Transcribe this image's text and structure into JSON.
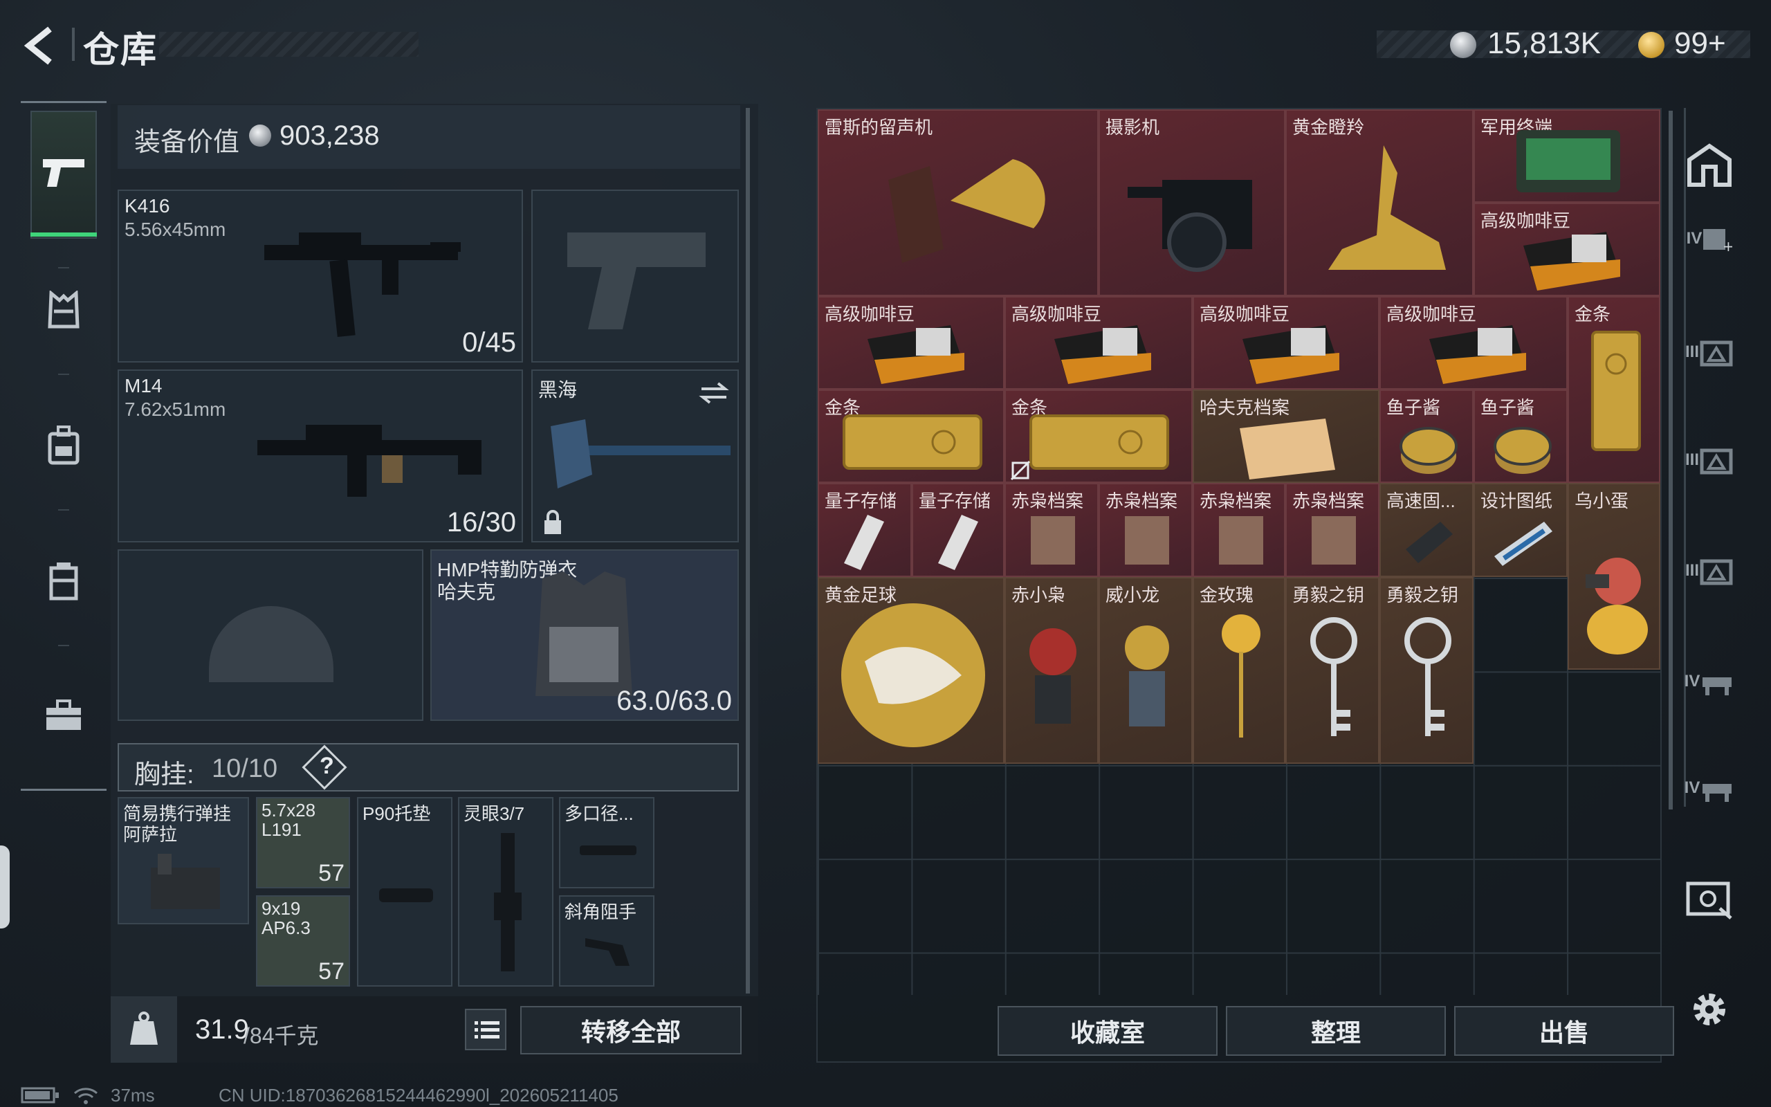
{
  "page_title": "仓库",
  "currency": {
    "silver": "15,813K",
    "gold": "99+"
  },
  "colors": {
    "accent_green": "#3fd47a",
    "item_red": "#5e2830",
    "item_gold": "#4e3a2c"
  },
  "left_nav": [
    "pistol-icon",
    "armor-icon",
    "backpack-icon",
    "chest-rig-icon",
    "briefcase-icon"
  ],
  "loadout": {
    "equip_value_label": "装备价值",
    "equip_value": "903,238",
    "primary": {
      "name": "K416",
      "caliber": "5.56x45mm",
      "ammo": "0/45"
    },
    "secondary": {
      "name": "M14",
      "caliber": "7.62x51mm",
      "ammo": "16/30"
    },
    "melee": {
      "name": "黑海"
    },
    "armor": {
      "name": "HMP特勤防弹衣",
      "sub": "哈夫克",
      "durability": "63.0/63.0"
    },
    "chest_rig": {
      "label": "胸挂:",
      "value": "10/10",
      "help": "?"
    },
    "rig_items": [
      {
        "name": "简易携行弹挂",
        "sub": "阿萨拉"
      },
      {
        "name": "5.7x28",
        "sub": "L191",
        "count": "57"
      },
      {
        "name": "P90托垫"
      },
      {
        "name": "灵眼3/7"
      },
      {
        "name": "多口径..."
      },
      {
        "name": "9x19",
        "sub": "AP6.3",
        "count": "57"
      },
      {
        "name": "斜角阻手"
      }
    ],
    "weight_value": "31.9",
    "weight_cap": "/84千克",
    "transfer_all": "转移全部"
  },
  "storage_items": [
    "雷斯的留声机",
    "摄影机",
    "黄金瞪羚",
    "军用终端",
    "高级咖啡豆",
    "高级咖啡豆",
    "高级咖啡豆",
    "高级咖啡豆",
    "高级咖啡豆",
    "金条",
    "金条",
    "金条",
    "哈夫克档案",
    "鱼子酱",
    "鱼子酱",
    "量子存储",
    "量子存储",
    "赤枭档案",
    "赤枭档案",
    "赤枭档案",
    "赤枭档案",
    "高速固...",
    "设计图纸",
    "乌小蛋",
    "黄金足球",
    "赤小枭",
    "威小龙",
    "金玫瑰",
    "勇毅之钥",
    "勇毅之钥"
  ],
  "buttons": {
    "collection": "收藏室",
    "sort": "整理",
    "sell": "出售"
  },
  "right_rail": [
    "exit-icon",
    "IV",
    "III",
    "III",
    "III",
    "IV",
    "IV",
    "scan-icon",
    "settings-icon"
  ],
  "status_bar": {
    "ping": "37ms",
    "uid": "CN UID:18703626815244462990l_202605211405"
  }
}
